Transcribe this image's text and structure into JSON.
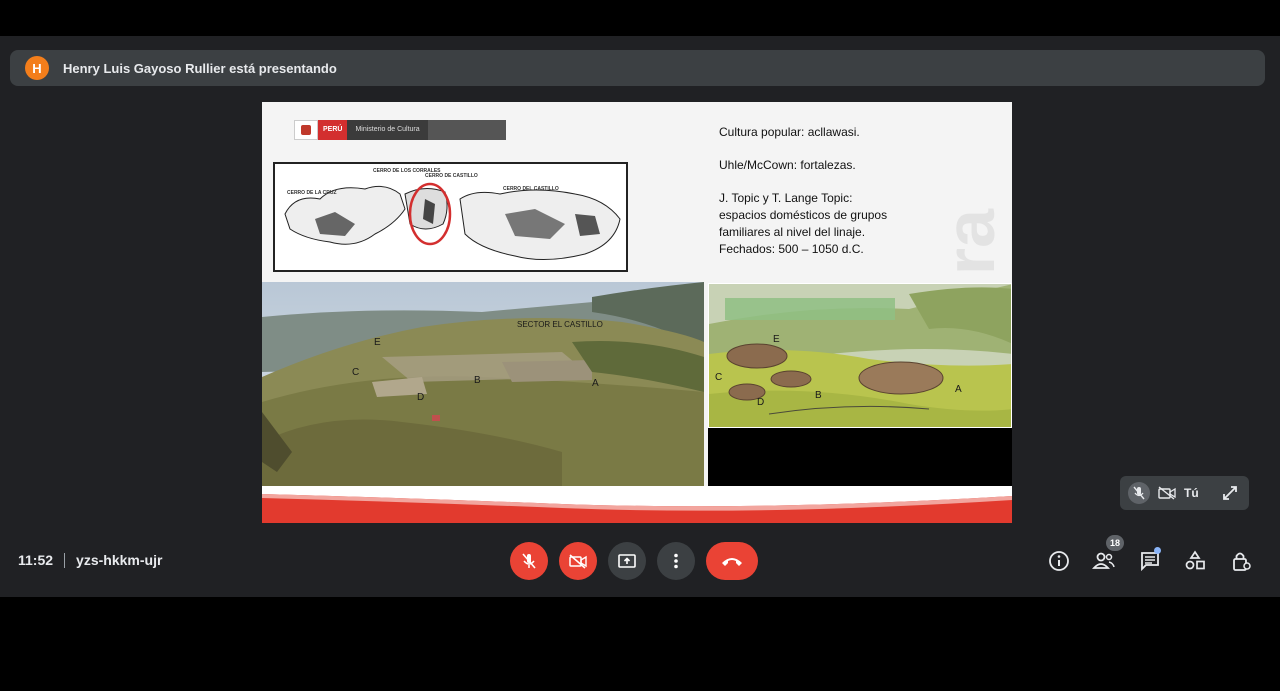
{
  "presenter_banner": {
    "avatar_initial": "H",
    "text": "Henry Luis Gayoso Rullier está presentando"
  },
  "slide": {
    "logo": {
      "country": "PERÚ",
      "ministry": "Ministerio de Cultura"
    },
    "text_lines": [
      "Cultura popular: acllawasi.",
      "Uhle/McCown: fortalezas.",
      "J. Topic y T. Lange Topic:",
      "espacios domésticos de grupos",
      "familiares al nivel del linaje.",
      "Fechados: 500 – 1050 d.C."
    ],
    "map_labels": {
      "cerro_corrales": "CERRO DE LOS CORRALES",
      "cerro_castillo": "CERRO DE CASTILLO",
      "cerro_cruz": "CERRO DE LA CRUZ",
      "cerro_sur": "CERRO DEL CASTILLO"
    },
    "photo": {
      "sector_label": "SECTOR EL CASTILLO",
      "letters": [
        "E",
        "C",
        "B",
        "D",
        "A"
      ]
    },
    "illustration_letters": [
      "E",
      "C",
      "D",
      "B",
      "A"
    ],
    "watermark": "ra"
  },
  "self_view": {
    "name": "Tú"
  },
  "meeting": {
    "time": "11:52",
    "code": "yzs-hkkm-ujr"
  },
  "right_controls": {
    "participants_count": "18"
  },
  "colors": {
    "meet_bg": "#202124",
    "banner_bg": "#3c4043",
    "red_button": "#ea4335",
    "gray_button": "#3c4043",
    "avatar": "#f37e1b",
    "accent_dot": "#8ab4f8"
  }
}
